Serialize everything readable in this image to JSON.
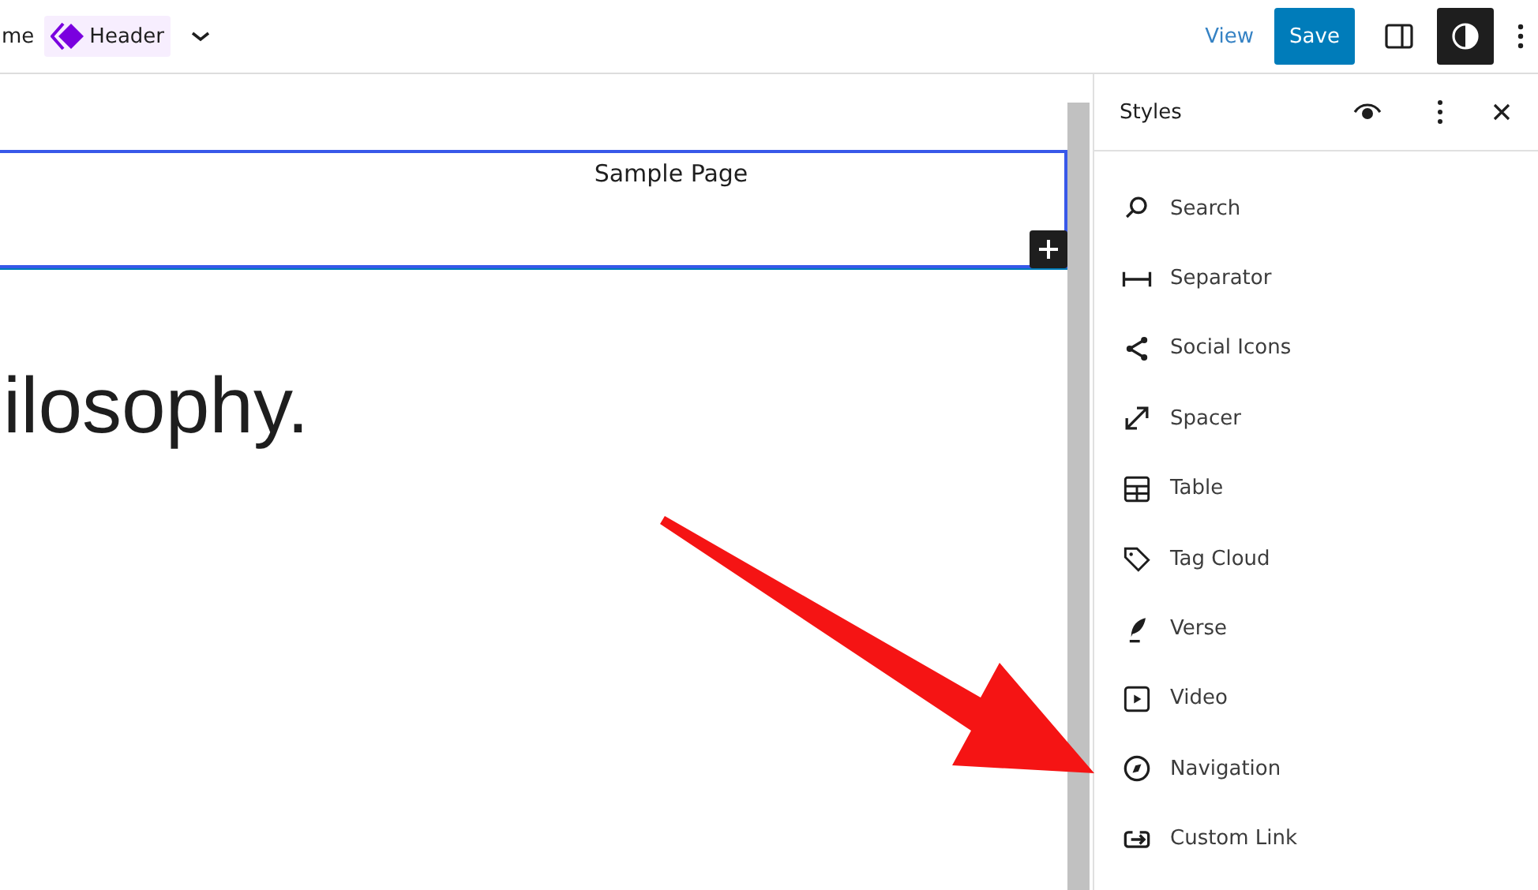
{
  "topbar": {
    "breadcrumb_start": "me",
    "template": "Header",
    "view_link": "View",
    "save_button": "Save",
    "styles_toggle": {
      "on": true
    }
  },
  "canvas": {
    "header_block": {
      "link": "Sample Page"
    },
    "heading": "ilosophy."
  },
  "styles_panel": {
    "title": "Styles",
    "items": [
      {
        "label": "Search"
      },
      {
        "label": "Separator"
      },
      {
        "label": "Social Icons"
      },
      {
        "label": "Spacer"
      },
      {
        "label": "Table"
      },
      {
        "label": "Tag Cloud"
      },
      {
        "label": "Verse"
      },
      {
        "label": "Video"
      },
      {
        "label": "Navigation"
      },
      {
        "label": "Custom Link"
      }
    ]
  }
}
